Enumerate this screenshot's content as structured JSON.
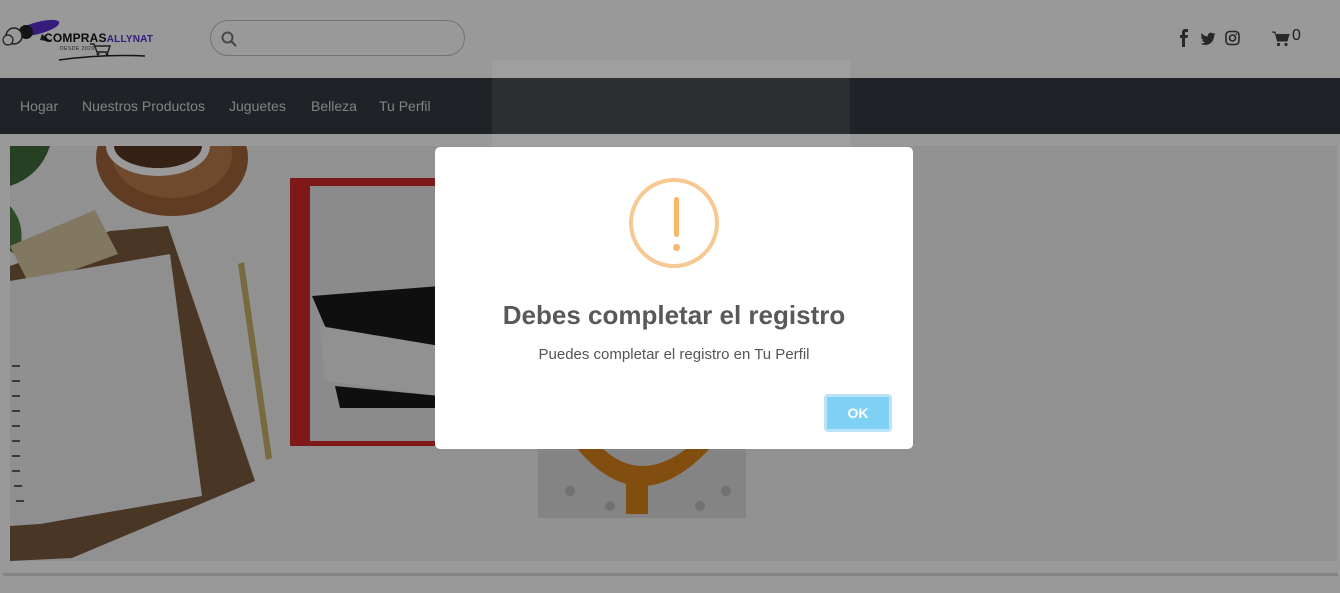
{
  "header": {
    "logo_text": "COMPRAS",
    "logo_accent": "ALLYNAT",
    "logo_sub": "DESDE  2020",
    "search_placeholder": "",
    "cart_count": "0",
    "social_icons": [
      "facebook-icon",
      "twitter-icon",
      "instagram-icon"
    ]
  },
  "nav": {
    "items": [
      "Hogar",
      "Nuestros Productos",
      "Juguetes",
      "Belleza",
      "Tu Perfil"
    ]
  },
  "dialog": {
    "icon": "warning-icon",
    "title": "Debes completar el registro",
    "text": "Puedes completar el registro en Tu Perfil",
    "ok_label": "OK"
  },
  "colors": {
    "nav_bg": "#343a40",
    "warning": "#f8bb86",
    "ok_button": "#7fd0f5",
    "brand_accent": "#5b2fd1"
  }
}
